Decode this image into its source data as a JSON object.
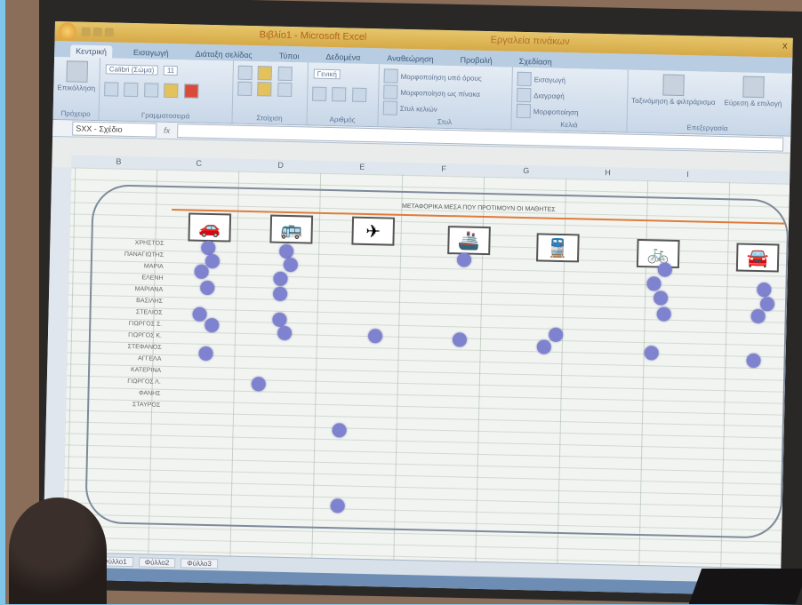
{
  "window": {
    "title": "Βιβλίο1 - Microsoft Excel",
    "context_tab": "Εργαλεία πινάκων",
    "close_label": "x"
  },
  "ribbon": {
    "tabs": [
      "Κεντρική",
      "Εισαγωγή",
      "Διάταξη σελίδας",
      "Τύποι",
      "Δεδομένα",
      "Αναθεώρηση",
      "Προβολή",
      "Σχεδίαση"
    ],
    "font_name": "Calibri (Σώμα)",
    "font_size": "11",
    "groups": {
      "clipboard": "Πρόχειρο",
      "font": "Γραμματοσειρά",
      "alignment": "Στοίχιση",
      "number": "Αριθμός",
      "styles": "Στυλ",
      "cells": "Κελιά",
      "editing": "Επεξεργασία"
    },
    "buttons": {
      "paste": "Επικόλληση",
      "cond_format": "Μορφοποίηση υπό όρους",
      "format_table": "Μορφοποίηση ως πίνακα",
      "cell_styles": "Στυλ κελιών",
      "insert": "Εισαγωγή",
      "delete": "Διαγραφή",
      "format": "Μορφοποίηση",
      "sort_filter": "Ταξινόμηση & φιλτράρισμα",
      "find_select": "Εύρεση & επιλογή",
      "number_format": "Γενική"
    }
  },
  "formula_bar": {
    "name_box": "SXX - Σχέδιο",
    "fx": "fx",
    "value": ""
  },
  "sheet": {
    "columns": [
      "B",
      "C",
      "D",
      "E",
      "F",
      "G",
      "H",
      "I"
    ],
    "header_text": "ΜΕΤΑΦΟΡΙΚΑ ΜΕΣΑ ΠΟΥ ΠΡΟΤΙΜΟΥΝ ΟΙ ΜΑΘΗΤΕΣ",
    "names": [
      "ΧΡΗΣΤΟΣ",
      "ΠΑΝΑΓΙΩΤΗΣ",
      "ΜΑΡΙΑ",
      "ΕΛΕΝΗ",
      "ΜΑΡΙΑΝΑ",
      "ΒΑΣΙΛΗΣ",
      "ΣΤΕΛΙΟΣ",
      "ΓΙΩΡΓΟΣ Σ.",
      "ΓΙΩΡΓΟΣ Κ.",
      "ΣΤΕΦΑΝΟΣ",
      "ΑΓΓΕΛΑ",
      "ΚΑΤΕΡΙΝΑ",
      "ΓΙΩΡΓΟΣ Λ.",
      "ΦΑΝΗΣ",
      "ΣΤΑΥΡΟΣ"
    ],
    "vehicles": [
      {
        "name": "car-red",
        "glyph": "🚗"
      },
      {
        "name": "bus",
        "glyph": "🚌"
      },
      {
        "name": "airplane",
        "glyph": "✈"
      },
      {
        "name": "ship",
        "glyph": "🚢"
      },
      {
        "name": "train",
        "glyph": "🚆"
      },
      {
        "name": "bicycle",
        "glyph": "🚲"
      },
      {
        "name": "car-orange",
        "glyph": "🚘"
      }
    ],
    "tabs": [
      "Φύλλο1",
      "Φύλλο2",
      "Φύλλο3"
    ]
  },
  "colors": {
    "dot": "#7f83cf",
    "header_line": "#e07b3a",
    "ribbon": "#c8d7e8",
    "titlebar": "#d6a947"
  }
}
